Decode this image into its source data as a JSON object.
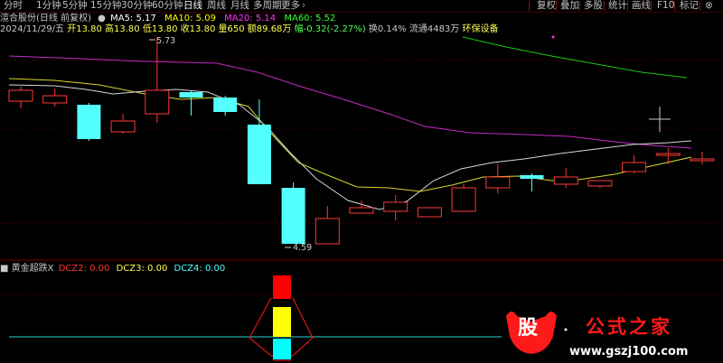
{
  "toolbar": {
    "periods": [
      "分时",
      "1分钟",
      "5分钟",
      "15分钟",
      "30分钟",
      "60分钟",
      "日线",
      "周线",
      "月线",
      "多周期",
      "更多"
    ],
    "active_period": "日线",
    "more_arrow": "›",
    "right_buttons": [
      "复权",
      "叠加",
      "多股",
      "统计",
      "画线",
      "F10",
      "标记"
    ],
    "close_glyph": "⊗",
    "prev_glyph": "◁",
    "next_glyph": "▷"
  },
  "chart_header": {
    "stock": "渲合股份(日线 前复权)",
    "ma5": "MA5: 5.17",
    "ma10": "MA10: 5.09",
    "ma20": "MA20: 5.14",
    "ma60": "MA60: 5.52",
    "colors": {
      "ma5": "#ffffff",
      "ma10": "#ffff00",
      "ma20": "#ff00ff",
      "ma60": "#00ff00"
    }
  },
  "info_line": {
    "date": "2024/11/29/五",
    "open": "开13.80",
    "high": "高13.80",
    "low": "低13.80",
    "close": "收13.80",
    "volume": "量650",
    "amount": "额89.68万",
    "change": "幅-0.32(-2.27%)",
    "turnover": "换0.14%",
    "float": "流通4483万",
    "sector": "环保设备"
  },
  "annotations": {
    "high": "5.73",
    "low": "4.59"
  },
  "indicator": {
    "name": "黄金超跌X",
    "dcz2": "DCZ2: 0.00",
    "dcz3": "DCZ3: 0.00",
    "dcz4": "DCZ4: 0.00"
  },
  "watermark": {
    "glyph": "股",
    "title": "公式之家",
    "url": "www.gszj100.com"
  },
  "chart_data": {
    "type": "candlestick",
    "high_label": 5.73,
    "low_label": 4.59,
    "candles": [
      {
        "open": 5.38,
        "close": 5.44,
        "high": 5.46,
        "low": 5.34
      },
      {
        "open": 5.37,
        "close": 5.41,
        "high": 5.45,
        "low": 5.35
      },
      {
        "open": 5.36,
        "close": 5.17,
        "high": 5.37,
        "low": 5.16
      },
      {
        "open": 5.21,
        "close": 5.27,
        "high": 5.31,
        "low": 5.2
      },
      {
        "open": 5.31,
        "close": 5.44,
        "high": 5.73,
        "low": 5.26
      },
      {
        "open": 5.43,
        "close": 5.4,
        "high": 5.44,
        "low": 5.3
      },
      {
        "open": 5.4,
        "close": 5.32,
        "high": 5.41,
        "low": 5.3
      },
      {
        "open": 5.25,
        "close": 4.92,
        "high": 5.39,
        "low": 4.92
      },
      {
        "open": 4.9,
        "close": 4.59,
        "high": 4.93,
        "low": 4.59
      },
      {
        "open": 4.59,
        "close": 4.73,
        "high": 4.8,
        "low": 4.59
      },
      {
        "open": 4.76,
        "close": 4.79,
        "high": 4.83,
        "low": 4.76
      },
      {
        "open": 4.77,
        "close": 4.82,
        "high": 4.86,
        "low": 4.72
      },
      {
        "open": 4.74,
        "close": 4.79,
        "high": 4.79,
        "low": 4.74
      },
      {
        "open": 4.77,
        "close": 4.9,
        "high": 4.92,
        "low": 4.77
      },
      {
        "open": 4.9,
        "close": 4.96,
        "high": 5.03,
        "low": 4.87
      },
      {
        "open": 4.97,
        "close": 4.95,
        "high": 4.98,
        "low": 4.88
      },
      {
        "open": 4.92,
        "close": 4.96,
        "high": 5.01,
        "low": 4.9
      },
      {
        "open": 4.91,
        "close": 4.94,
        "high": 4.94,
        "low": 4.9
      },
      {
        "open": 4.99,
        "close": 5.04,
        "high": 5.08,
        "low": 4.98
      },
      {
        "open": 5.09,
        "close": 5.09,
        "high": 5.12,
        "low": 5.03
      },
      {
        "open": 5.06,
        "close": 5.06,
        "high": 5.1,
        "low": 5.03
      }
    ]
  }
}
